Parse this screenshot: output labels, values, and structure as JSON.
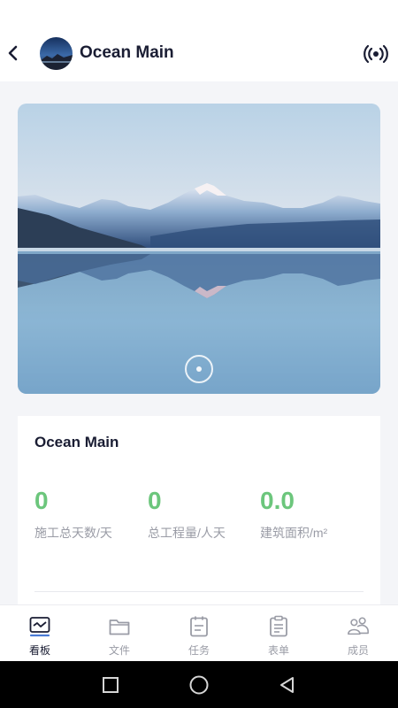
{
  "header": {
    "title": "Ocean Main",
    "back_icon": "chevron-left-icon",
    "avatar_icon": "project-avatar",
    "action_icon": "broadcast-icon"
  },
  "hero": {
    "image": "mountain-lake-landscape",
    "carousel_indicator": "play-dot-icon"
  },
  "card": {
    "title": "Ocean Main",
    "stats": [
      {
        "value": "0",
        "label": "施工总天数/天"
      },
      {
        "value": "0",
        "label": "总工程量/人天"
      },
      {
        "value": "0.0",
        "label": "建筑面积/m²"
      }
    ]
  },
  "tabbar": {
    "active_index": 0,
    "tabs": [
      {
        "label": "看板",
        "icon": "dashboard-icon"
      },
      {
        "label": "文件",
        "icon": "folder-icon"
      },
      {
        "label": "任务",
        "icon": "task-icon"
      },
      {
        "label": "表单",
        "icon": "form-icon"
      },
      {
        "label": "成员",
        "icon": "members-icon"
      }
    ]
  },
  "system_nav": [
    "recent-apps-icon",
    "home-icon",
    "back-icon"
  ],
  "colors": {
    "accent_green": "#6cc67c",
    "title_text": "#1a1d33",
    "muted_text": "#9a9ca6",
    "background": "#f4f5f8"
  }
}
